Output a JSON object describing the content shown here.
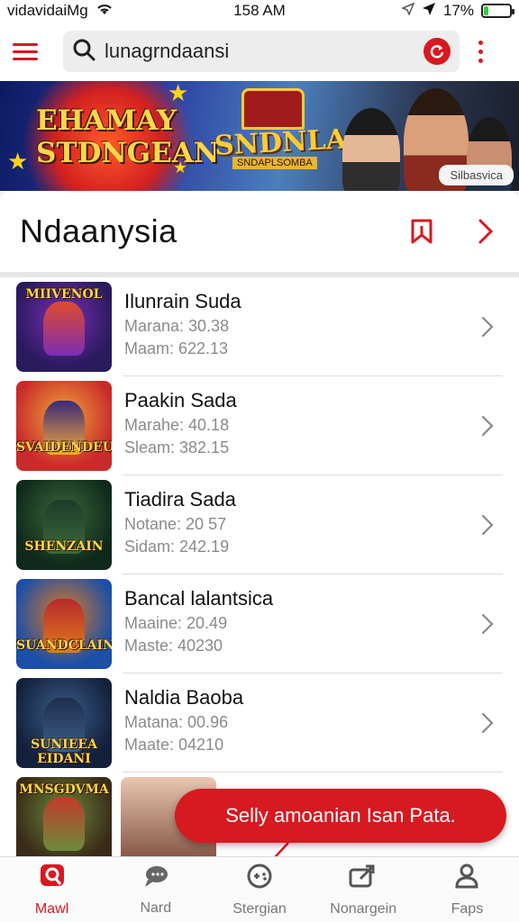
{
  "status_bar": {
    "carrier": "vidavidaiMg",
    "time": "158 AM",
    "battery": "17%",
    "battery_level": 0.17
  },
  "app_bar": {
    "search_value": "lunagrndaansi",
    "accent_color": "#d71920"
  },
  "banner": {
    "title_line1": "EHAMAY",
    "title_line2": "STDNGEAN",
    "title_center": "SNDNLAIN",
    "title_center_sub": "SNDAPLSOMBA",
    "chip_label": "Silbasvica"
  },
  "section": {
    "title": "Ndaanysia"
  },
  "list": {
    "items": [
      {
        "title": "Ilunrain Suda",
        "line1": "Marana: 30.38",
        "line2": "Maam: 622.13",
        "thumb_text": "MIIVENOL",
        "thumb_colors": [
          "#2a1a5e",
          "#7b2db5",
          "#e04a2a"
        ]
      },
      {
        "title": "Paakin Sada",
        "line1": "Marahe: 40.18",
        "line2": "Sleam: 382.15",
        "thumb_text": "SVAIDENDEU",
        "thumb_colors": [
          "#c92a2a",
          "#f2a73b",
          "#3a2a7a"
        ]
      },
      {
        "title": "Tiadira Sada",
        "line1": "Notane: 20 57",
        "line2": "Sidam: 242.19",
        "thumb_text": "SHENZAIN",
        "thumb_colors": [
          "#0f2a1c",
          "#3c6a3a",
          "#1d3b2a"
        ]
      },
      {
        "title": "Bancal lalantsica",
        "line1": "Maaine: 20.49",
        "line2": "Maste: 40230",
        "thumb_text": "SUANDCLAIN",
        "thumb_colors": [
          "#1c4fa8",
          "#e07a1e",
          "#b52a2a"
        ]
      },
      {
        "title": "Naldia Baoba",
        "line1": "Matana: 00.96",
        "line2": "Maate: 04210",
        "thumb_text": "SUNIEEA EIDANI",
        "thumb_colors": [
          "#14213d",
          "#3b5f8a",
          "#1f2e4d"
        ]
      },
      {
        "title": "",
        "line1": "",
        "line2": "",
        "thumb_text": "MNSGDVMA",
        "thumb_colors": [
          "#3a2a18",
          "#6b8a3a",
          "#c23a2a"
        ]
      }
    ]
  },
  "toast": {
    "text": "Selly amoanian Isan Pata."
  },
  "bottom_nav": {
    "items": [
      {
        "label": "Mawl",
        "icon": "q-logo-icon",
        "active": true
      },
      {
        "label": "Nard",
        "icon": "chat-bubbles-icon",
        "active": false
      },
      {
        "label": "Stergian",
        "icon": "game-controller-icon",
        "active": false
      },
      {
        "label": "Nonargein",
        "icon": "share-arrow-icon",
        "active": false
      },
      {
        "label": "Faps",
        "icon": "person-icon",
        "active": false
      }
    ]
  }
}
